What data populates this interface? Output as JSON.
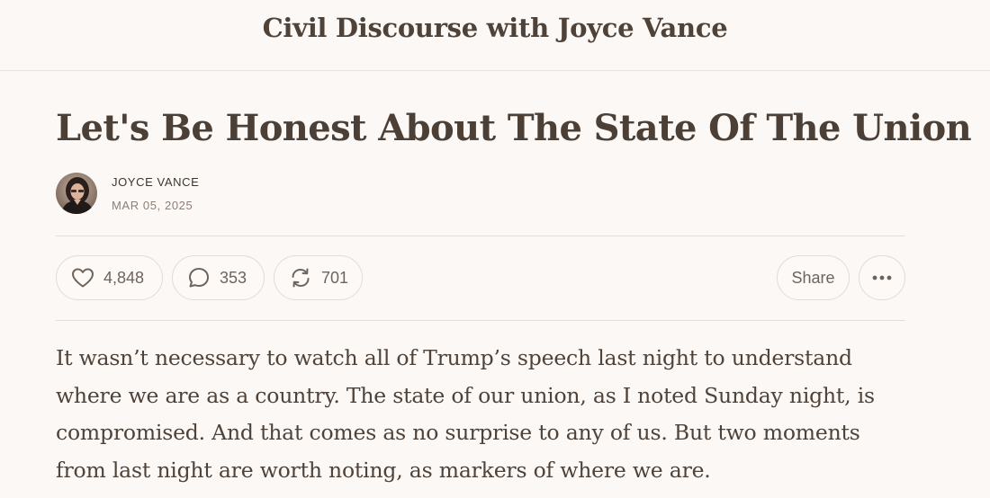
{
  "header": {
    "publication_title": "Civil Discourse with Joyce Vance"
  },
  "post": {
    "title": "Let's Be Honest About The State Of The Union",
    "author": "JOYCE VANCE",
    "date": "MAR 05, 2025"
  },
  "actions": {
    "likes": "4,848",
    "comments": "353",
    "restacks": "701",
    "share_label": "Share",
    "more_icon": "ellipsis-icon"
  },
  "body": {
    "lines": [
      "It wasn’t necessary to watch all of Trump’s speech last night to understand",
      "where we are as a country. The state of our union, as I noted Sunday night, is",
      "compromised. And that comes as no surprise to any of us. But two moments",
      "from last night are worth noting, as markers of where we are."
    ]
  },
  "colors": {
    "background": "#fcf8f5",
    "text": "#4a3e36",
    "muted": "#8a7f77",
    "border": "#e6ded8"
  }
}
